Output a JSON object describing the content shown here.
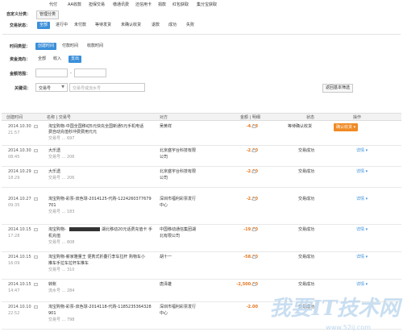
{
  "top_tabs": [
    "代付",
    "AA收款",
    "担保交易",
    "缴通讯费",
    "还信用卡",
    "捐款",
    "红包获取",
    "集分宝获取"
  ],
  "custom_category": {
    "label": "自定义分类：",
    "button": "管理分类"
  },
  "status_filter": {
    "label": "交易状态：",
    "options": [
      "全部",
      "进行中",
      "未付款",
      "等待发货",
      "未确认收货",
      "退款",
      "成功",
      "失败"
    ],
    "selected": "全部"
  },
  "time_type": {
    "label": "时间类型：",
    "options": [
      "创建时间",
      "付款时间",
      "收款时间"
    ],
    "selected": "创建时间"
  },
  "fund_flow": {
    "label": "资金流向：",
    "options": [
      "全部",
      "收入",
      "支出"
    ],
    "selected": "支出"
  },
  "amount_range": {
    "label": "金额范围：",
    "separator": "-"
  },
  "keyword": {
    "label": "关键词：",
    "select_value": "交易号",
    "placeholder": "交易号或流水号",
    "back_link": "返回基本筛选"
  },
  "table": {
    "headers": [
      "创建时间",
      "名称 | 交易号",
      "对方",
      "金额 | 明细",
      "状态",
      "操作"
    ],
    "rows": [
      {
        "date": "2014.10.30",
        "time": "21:57",
        "name_line1": "淘宝购物-中国全国移动5元快充全国新通5元手机电话",
        "name_line2": "费自动充值秒冲费费用元元",
        "trade_no": "交易号 ... 697",
        "counterparty": "吴黄祥",
        "amount": "-4.98",
        "status": "等待确认收货",
        "action": "确认收货"
      },
      {
        "date": "2014.10.30",
        "time": "08:45",
        "name_line1": "大乐透",
        "name_line2": "",
        "trade_no": "交易号 ... 206",
        "counterparty": "北京盛宇台科技有限",
        "counterparty2": "公司",
        "amount": "-2.00",
        "status": "交易成功",
        "action": "详情"
      },
      {
        "date": "2014.10.29",
        "time": "18:29",
        "name_line1": "大乐透",
        "name_line2": "",
        "trade_no": "交易号 ... 206",
        "counterparty": "北京盛宇台科技有限",
        "counterparty2": "公司",
        "amount": "-2.00",
        "status": "交易成功",
        "action": "详情"
      },
      {
        "date": "2014.10.27",
        "time": "09:35",
        "name_line1": "淘宝购物-彩票-双色球-2014125-代购-1224260377679",
        "name_line2": "701",
        "trade_no": "交易号 ... 183",
        "counterparty": "深圳市福利彩票发行",
        "counterparty2": "中心",
        "amount": "-2.00",
        "status": "交易成功",
        "action": "详情"
      },
      {
        "date": "2014.10.15",
        "time": "17:28",
        "name_line1": "淘宝购物-",
        "name_line1b": "湖北移动20元话费充值卡 手",
        "name_line2": "机充值",
        "trade_no": "交易号 ... 808",
        "counterparty": "中国移动通信集团湖",
        "counterparty2": "北有限公司",
        "amount": "-19.70",
        "status": "交易成功",
        "action": "详情"
      },
      {
        "date": "2014.10.15",
        "time": "16:09",
        "name_line1": "淘宝购物-薪家雅量王 便携式折叠行李车拉杆 购物车小",
        "name_line2": "推车手拉车拉杆车推车",
        "trade_no": "交易号 ... 310",
        "counterparty": "胡十一",
        "amount": "-58.00",
        "status": "交易成功",
        "action": "详情"
      },
      {
        "date": "2014.10.15",
        "time": "14:47",
        "name_line1": "转账",
        "name_line2": "",
        "trade_no": "流水号 ... 284",
        "counterparty": "唐泽雄",
        "amount": "-2,500.00",
        "status": "交易成功",
        "action": "详情"
      },
      {
        "date": "2014.10.10",
        "time": "22:52",
        "name_line1": "淘宝购物-彩票-双色球-2014118-代购-1185235364328",
        "name_line2": "901",
        "trade_no": "交易号 ... 798",
        "counterparty": "深圳市福利彩票发行",
        "counterparty2": "中心",
        "amount": "-2.00",
        "status": "交易成功",
        "action": "详情"
      }
    ]
  },
  "watermark": {
    "main": "我要IT技术网",
    "sub": "www.52ij.com"
  },
  "colors": {
    "accent": "#3b8fd9",
    "amount": "#e4751d",
    "action_button": "#f08a24"
  }
}
